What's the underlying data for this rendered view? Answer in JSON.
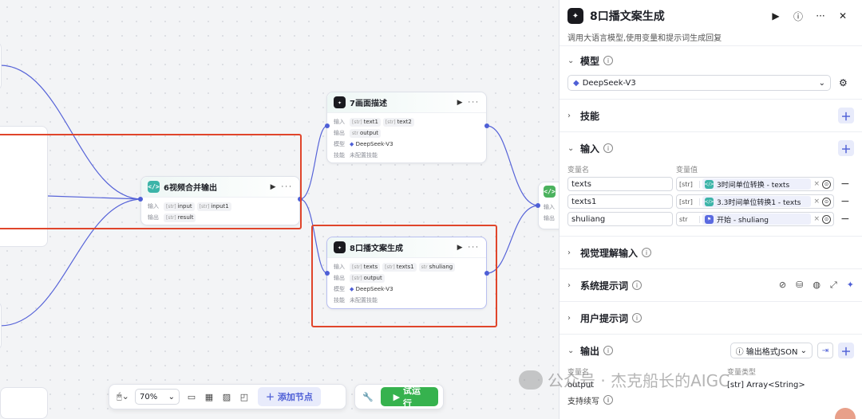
{
  "canvas": {
    "nodes": {
      "merge": {
        "title": "6视频合并输出",
        "icon": "code-icon",
        "input_label": "输入",
        "inputs": [
          {
            "type": "[str]",
            "name": "input"
          },
          {
            "type": "[str]",
            "name": "input1"
          }
        ],
        "output_label": "输出",
        "outputs": [
          {
            "type": "[str]",
            "name": "result"
          }
        ]
      },
      "describe": {
        "title": "7画面描述",
        "icon": "llm-icon",
        "input_label": "输入",
        "inputs": [
          {
            "type": "[str]",
            "name": "text1"
          },
          {
            "type": "[str]",
            "name": "text2"
          }
        ],
        "output_label": "输出",
        "outputs": [
          {
            "type": "str",
            "name": "output"
          }
        ],
        "model_label": "模型",
        "model": "DeepSeek-V3",
        "skill_label": "技能",
        "skill_value": "未配置技能"
      },
      "script": {
        "title": "8口播文案生成",
        "icon": "llm-icon",
        "input_label": "输入",
        "inputs": [
          {
            "type": "[str]",
            "name": "texts"
          },
          {
            "type": "[str]",
            "name": "texts1"
          },
          {
            "type": "str",
            "name": "shuliang"
          }
        ],
        "output_label": "输出",
        "outputs": [
          {
            "type": "[str]",
            "name": "output"
          }
        ],
        "model_label": "模型",
        "model": "DeepSeek-V3",
        "skill_label": "技能",
        "skill_value": "未配置技能"
      },
      "right_partial": {
        "input_label": "输入",
        "output_label": "输出"
      }
    },
    "toolbar": {
      "zoom": "70%",
      "add_node": "添加节点",
      "run": "试运行"
    }
  },
  "panel": {
    "title": "8口播文案生成",
    "description": "调用大语言模型,使用变量和提示词生成回复",
    "model_section": {
      "title": "模型",
      "selected": "DeepSeek-V3"
    },
    "skills_section": {
      "title": "技能"
    },
    "input_section": {
      "title": "输入",
      "col_name": "变量名",
      "col_value": "变量值",
      "rows": [
        {
          "name": "texts",
          "type": "[str]",
          "ref": "3时间单位转换 - texts",
          "ref_icon": "code-icon"
        },
        {
          "name": "texts1",
          "type": "[str]",
          "ref": "3.3时间单位转换1 - texts",
          "ref_icon": "code-icon"
        },
        {
          "name": "shuliang",
          "type": "str",
          "ref": "开始 - shuliang",
          "ref_icon": "start-icon"
        }
      ]
    },
    "vision_section": {
      "title": "视觉理解输入"
    },
    "system_prompt_section": {
      "title": "系统提示词"
    },
    "user_prompt_section": {
      "title": "用户提示词"
    },
    "output_section": {
      "title": "输出",
      "format": "输出格式JSON",
      "col_name": "变量名",
      "col_type": "变量类型",
      "row_name": "output",
      "row_type": "[str] Array<String>"
    },
    "stream_label": "支持续写"
  },
  "watermark": "公众号 · 杰克船长的AIGC",
  "colors": {
    "accent": "#4e5fd6",
    "run": "#36b24e",
    "highlight": "#e0452b"
  }
}
